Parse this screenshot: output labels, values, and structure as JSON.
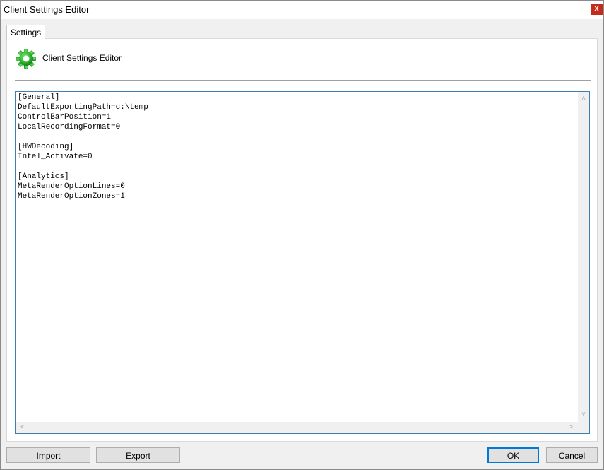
{
  "window": {
    "title": "Client Settings Editor",
    "close_label": "x"
  },
  "tabs": [
    {
      "label": "Settings"
    }
  ],
  "header": {
    "title": "Client Settings Editor",
    "icon": "gear-icon"
  },
  "editor": {
    "content": "[General]\nDefaultExportingPath=c:\\temp\nControlBarPosition=1\nLocalRecordingFormat=0\n\n[HWDecoding]\nIntel_Activate=0\n\n[Analytics]\nMetaRenderOptionLines=0\nMetaRenderOptionZones=1"
  },
  "buttons": {
    "import_label": "Import",
    "export_label": "Export",
    "ok_label": "OK",
    "cancel_label": "Cancel"
  },
  "colors": {
    "accent": "#0078d7",
    "close": "#c42b1c",
    "icon_green": "#2db52d"
  }
}
